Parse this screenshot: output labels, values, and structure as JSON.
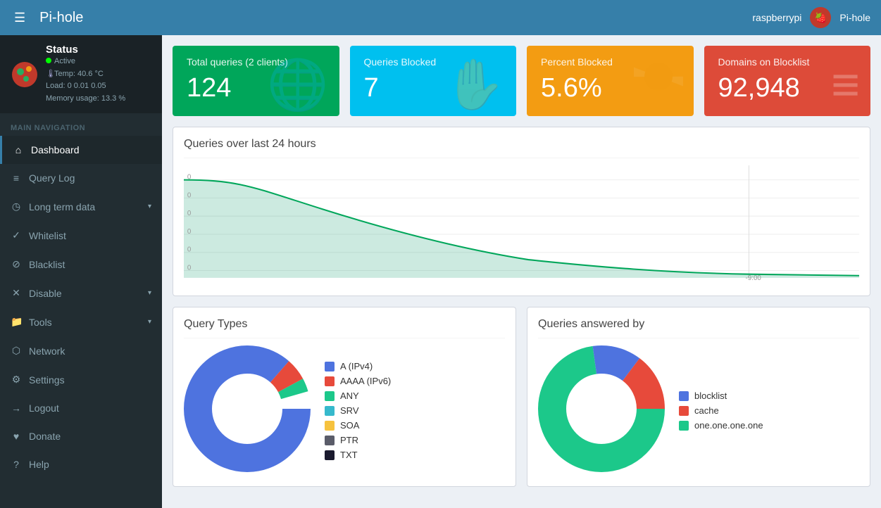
{
  "navbar": {
    "brand": "Pi-hole",
    "brand_pi": "Pi-",
    "brand_hole": "hole",
    "hamburger_icon": "☰",
    "hostname": "raspberrypi",
    "pihole_label": "Pi-hole"
  },
  "sidebar": {
    "status": {
      "title": "Status",
      "active_label": "Active",
      "temp_label": "Temp: 40.6 °C",
      "load_label": "Load: 0  0.01  0.05",
      "memory_label": "Memory usage: 13.3 %"
    },
    "section_label": "MAIN NAVIGATION",
    "items": [
      {
        "id": "dashboard",
        "label": "Dashboard",
        "icon": "⌂",
        "active": true
      },
      {
        "id": "query-log",
        "label": "Query Log",
        "icon": "≡"
      },
      {
        "id": "long-term-data",
        "label": "Long term data",
        "icon": "◷",
        "has_arrow": true
      },
      {
        "id": "whitelist",
        "label": "Whitelist",
        "icon": "✓"
      },
      {
        "id": "blacklist",
        "label": "Blacklist",
        "icon": "⊘"
      },
      {
        "id": "disable",
        "label": "Disable",
        "icon": "✕",
        "has_arrow": true
      },
      {
        "id": "tools",
        "label": "Tools",
        "icon": "📁",
        "has_arrow": true
      },
      {
        "id": "network",
        "label": "Network",
        "icon": "⬡"
      },
      {
        "id": "settings",
        "label": "Settings",
        "icon": "⚙"
      },
      {
        "id": "logout",
        "label": "Logout",
        "icon": "→"
      },
      {
        "id": "donate",
        "label": "Donate",
        "icon": "♥"
      },
      {
        "id": "help",
        "label": "Help",
        "icon": "?"
      }
    ]
  },
  "stats": {
    "total_queries": {
      "title": "Total queries (2 clients)",
      "value": "124",
      "icon": "🌐"
    },
    "queries_blocked": {
      "title": "Queries Blocked",
      "value": "7",
      "icon": "✋"
    },
    "percent_blocked": {
      "title": "Percent Blocked",
      "value": "5.6%",
      "icon": "◔"
    },
    "domains_on_blocklist": {
      "title": "Domains on Blocklist",
      "value": "92,948",
      "icon": "≡"
    }
  },
  "chart": {
    "title": "Queries over last 24 hours",
    "x_label": "-9:00",
    "y_labels": [
      "0",
      "0",
      "0",
      "0",
      "0",
      "0"
    ]
  },
  "query_types": {
    "title": "Query Types",
    "legend": [
      {
        "label": "A (IPv4)",
        "color": "#4e73df"
      },
      {
        "label": "AAAA (IPv6)",
        "color": "#e74a3b"
      },
      {
        "label": "ANY",
        "color": "#1cc88a"
      },
      {
        "label": "SRV",
        "color": "#36b9cc"
      },
      {
        "label": "SOA",
        "color": "#f6c23e"
      },
      {
        "label": "PTR",
        "color": "#5a5c69"
      },
      {
        "label": "TXT",
        "color": "#1a1a2e"
      }
    ]
  },
  "queries_answered": {
    "title": "Queries answered by",
    "legend": [
      {
        "label": "blocklist",
        "color": "#4e73df"
      },
      {
        "label": "cache",
        "color": "#e74a3b"
      },
      {
        "label": "one.one.one.one",
        "color": "#1cc88a"
      }
    ]
  }
}
